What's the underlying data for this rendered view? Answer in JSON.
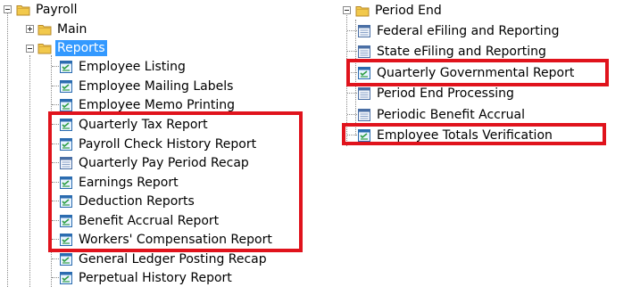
{
  "left_tree": {
    "root_label": "Payroll",
    "main_label": "Main",
    "reports_label": "Reports",
    "reports_items": [
      "Employee Listing",
      "Employee Mailing Labels",
      "Employee Memo Printing",
      "Quarterly Tax Report",
      "Payroll Check History Report",
      "Quarterly Pay Period Recap",
      "Earnings Report",
      "Deduction Reports",
      "Benefit Accrual Report",
      "Workers' Compensation Report",
      "General Ledger Posting Recap",
      "Perpetual History Report"
    ]
  },
  "right_tree": {
    "root_label": "Period End",
    "items": [
      "Federal eFiling and Reporting",
      "State eFiling and Reporting",
      "Quarterly Governmental Report",
      "Period End Processing",
      "Periodic Benefit Accrual",
      "Employee Totals Verification"
    ]
  },
  "highlight_color": "#e0131c",
  "selection_color": "#3399ff"
}
